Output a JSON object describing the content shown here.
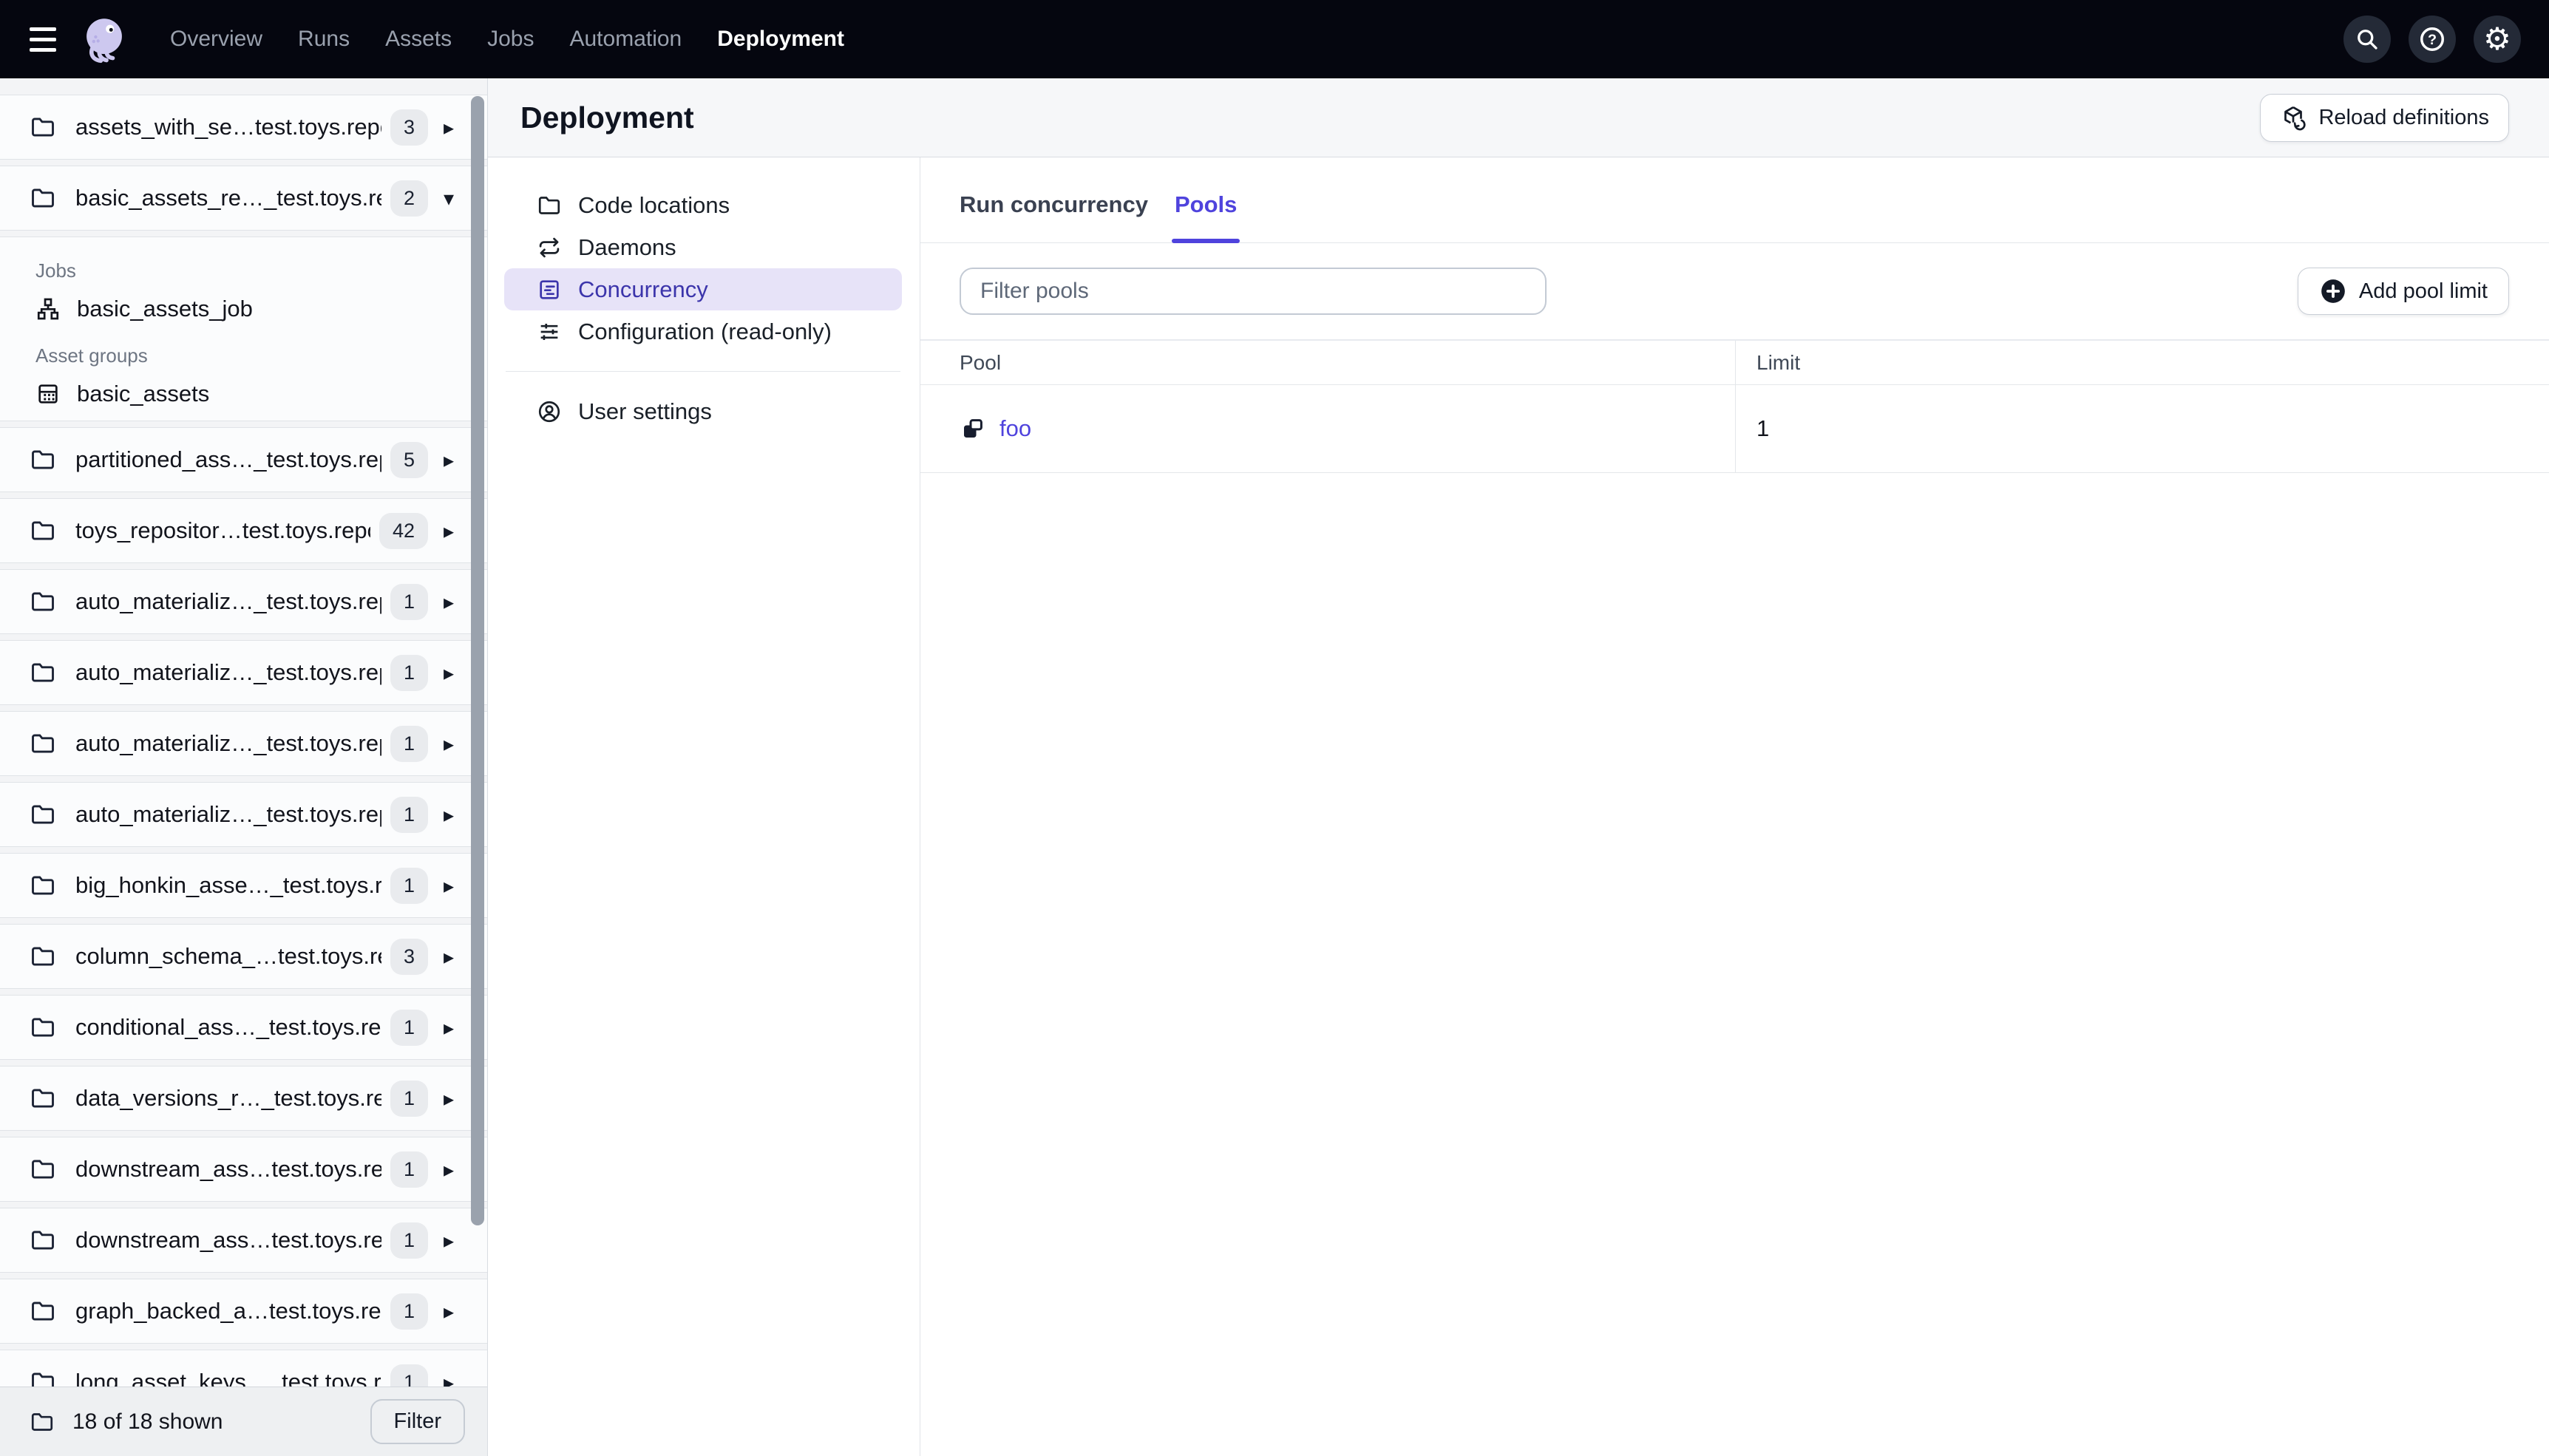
{
  "topnav": {
    "items": [
      "Overview",
      "Runs",
      "Assets",
      "Jobs",
      "Automation",
      "Deployment"
    ],
    "active": "Deployment"
  },
  "icons": {
    "gear": "⚙",
    "help_glyph": "?",
    "chevron_collapsed": "▸",
    "chevron_expanded": "▾"
  },
  "sidebar": {
    "repos": [
      {
        "name": "assets_with_se…test.toys.repo",
        "count": "3",
        "expanded": false
      },
      {
        "name": "basic_assets_re…_test.toys.rep",
        "count": "2",
        "expanded": true
      },
      {
        "name": "partitioned_ass…_test.toys.rep",
        "count": "5",
        "expanded": false
      },
      {
        "name": "toys_repositor…test.toys.repo",
        "count": "42",
        "expanded": false
      },
      {
        "name": "auto_materializ…_test.toys.repo",
        "count": "1",
        "expanded": false
      },
      {
        "name": "auto_materializ…_test.toys.repo",
        "count": "1",
        "expanded": false
      },
      {
        "name": "auto_materializ…_test.toys.repo",
        "count": "1",
        "expanded": false
      },
      {
        "name": "auto_materializ…_test.toys.repo",
        "count": "1",
        "expanded": false
      },
      {
        "name": "big_honkin_asse…_test.toys.rep",
        "count": "1",
        "expanded": false
      },
      {
        "name": "column_schema_…test.toys.rep",
        "count": "3",
        "expanded": false
      },
      {
        "name": "conditional_ass…_test.toys.repo",
        "count": "1",
        "expanded": false
      },
      {
        "name": "data_versions_r…_test.toys.rep",
        "count": "1",
        "expanded": false
      },
      {
        "name": "downstream_ass…test.toys.rep",
        "count": "1",
        "expanded": false
      },
      {
        "name": "downstream_ass…test.toys.rep",
        "count": "1",
        "expanded": false
      },
      {
        "name": "graph_backed_a…test.toys.repo",
        "count": "1",
        "expanded": false
      },
      {
        "name": "long_asset_keys…_test.toys.rep",
        "count": "1",
        "expanded": false
      }
    ],
    "groups": {
      "jobs_label": "Jobs",
      "jobs": [
        "basic_assets_job"
      ],
      "asset_groups_label": "Asset groups",
      "asset_groups": [
        "basic_assets"
      ]
    },
    "footer": {
      "summary": "18 of 18 shown",
      "filter_label": "Filter"
    }
  },
  "main": {
    "title": "Deployment",
    "reload_label": "Reload definitions",
    "nav": {
      "items": [
        "Code locations",
        "Daemons",
        "Concurrency",
        "Configuration (read-only)",
        "User settings"
      ],
      "active": "Concurrency"
    },
    "tabs": {
      "items": [
        "Run concurrency",
        "Pools"
      ],
      "active": "Pools"
    },
    "filter_placeholder": "Filter pools",
    "add_button_label": "Add pool limit",
    "table": {
      "columns": [
        "Pool",
        "Limit"
      ],
      "rows": [
        {
          "pool": "foo",
          "limit": "1"
        }
      ]
    }
  },
  "colors": {
    "nav_bg": "#05060f",
    "accent": "#4f43dd",
    "selected_nav_bg": "#e7e3f8",
    "selected_nav_text": "#3c35ab",
    "sidebar_bg": "#f3f4f6",
    "header_band_bg": "#f6f7f9",
    "logo_lavender": "#cdc8ef"
  }
}
